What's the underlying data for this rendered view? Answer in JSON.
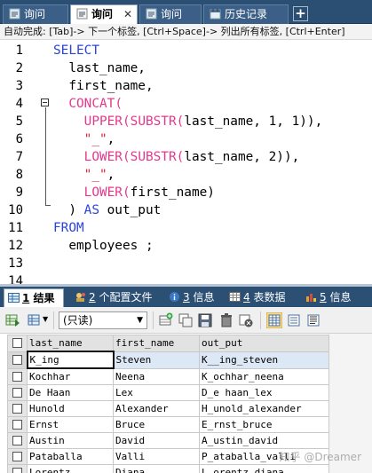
{
  "query_tabs": [
    {
      "label": "询问",
      "active": false,
      "icon": "query-doc-icon"
    },
    {
      "label": "询问",
      "active": true,
      "icon": "query-doc-icon",
      "close": "✕"
    },
    {
      "label": "询问",
      "active": false,
      "icon": "query-doc-icon"
    },
    {
      "label": "历史记录",
      "active": false,
      "icon": "history-icon"
    }
  ],
  "add_tab": "+",
  "autocomplete_hint": "自动完成: [Tab]-> 下一个标签, [Ctrl+Space]-> 列出所有标签, [Ctrl+Enter]",
  "editor": {
    "line_numbers": [
      "1",
      "2",
      "3",
      "4",
      "5",
      "6",
      "7",
      "8",
      "9",
      "10",
      "11",
      "12",
      "13",
      "14"
    ],
    "lines": [
      [
        {
          "t": "SELECT",
          "c": "kw"
        }
      ],
      [
        {
          "t": "  last_name,",
          "c": "id"
        }
      ],
      [
        {
          "t": "  first_name,",
          "c": "id"
        }
      ],
      [
        {
          "t": "  ",
          "c": "id"
        },
        {
          "t": "CONCAT",
          "c": "fn"
        },
        {
          "t": "(",
          "c": "fn"
        }
      ],
      [
        {
          "t": "    ",
          "c": "id"
        },
        {
          "t": "UPPER",
          "c": "fn"
        },
        {
          "t": "(",
          "c": "fn"
        },
        {
          "t": "SUBSTR",
          "c": "fn"
        },
        {
          "t": "(",
          "c": "fn"
        },
        {
          "t": "last_name, 1, 1)),",
          "c": "id"
        }
      ],
      [
        {
          "t": "    ",
          "c": "id"
        },
        {
          "t": "\"_\"",
          "c": "str"
        },
        {
          "t": ",",
          "c": "id"
        }
      ],
      [
        {
          "t": "    ",
          "c": "id"
        },
        {
          "t": "LOWER",
          "c": "fn"
        },
        {
          "t": "(",
          "c": "fn"
        },
        {
          "t": "SUBSTR",
          "c": "fn"
        },
        {
          "t": "(",
          "c": "fn"
        },
        {
          "t": "last_name, 2)),",
          "c": "id"
        }
      ],
      [
        {
          "t": "    ",
          "c": "id"
        },
        {
          "t": "\"_\"",
          "c": "str"
        },
        {
          "t": ",",
          "c": "id"
        }
      ],
      [
        {
          "t": "    ",
          "c": "id"
        },
        {
          "t": "LOWER",
          "c": "fn"
        },
        {
          "t": "(",
          "c": "fn"
        },
        {
          "t": "first_name)",
          "c": "id"
        }
      ],
      [
        {
          "t": "  ) ",
          "c": "id"
        },
        {
          "t": "AS",
          "c": "kw"
        },
        {
          "t": " out_put",
          "c": "id"
        }
      ],
      [
        {
          "t": "FROM",
          "c": "kw"
        }
      ],
      [
        {
          "t": "  employees ;",
          "c": "id"
        }
      ],
      [],
      []
    ]
  },
  "result_tabs": [
    {
      "num": "1",
      "label": "结果",
      "active": true,
      "icon": "grid-results-icon"
    },
    {
      "num": "2",
      "label": "个配置文件",
      "active": false,
      "icon": "profile-icon"
    },
    {
      "num": "3",
      "label": "信息",
      "active": false,
      "icon": "info-icon"
    },
    {
      "num": "4",
      "label": "表数据",
      "active": false,
      "icon": "table-data-icon"
    },
    {
      "num": "5",
      "label": "信息",
      "active": false,
      "icon": "info-pie-icon"
    }
  ],
  "toolbar": {
    "readonly_select": "(只读)"
  },
  "grid": {
    "columns": [
      "last_name",
      "first_name",
      "out_put"
    ],
    "rows": [
      [
        "K_ing",
        "Steven",
        "K__ing_steven"
      ],
      [
        "Kochhar",
        "Neena",
        "K_ochhar_neena"
      ],
      [
        "De Haan",
        "Lex",
        "D_e haan_lex"
      ],
      [
        "Hunold",
        "Alexander",
        "H_unold_alexander"
      ],
      [
        "Ernst",
        "Bruce",
        "E_rnst_bruce"
      ],
      [
        "Austin",
        "David",
        "A_ustin_david"
      ],
      [
        "Pataballa",
        "Valli",
        "P_ataballa_valli"
      ],
      [
        "Lorentz",
        "Diana",
        "L_orentz_diana"
      ]
    ]
  },
  "watermark": "知乎 @Dreamer",
  "colors": {
    "keyword": "#2a44d6",
    "function": "#e4388d",
    "string": "#d62a3a",
    "tab_bar": "#2b4e73"
  }
}
